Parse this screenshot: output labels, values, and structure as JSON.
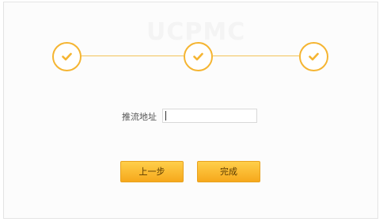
{
  "header": {
    "watermark_text": "UCPMC"
  },
  "steps": [
    {
      "state": "complete",
      "icon": "check-icon"
    },
    {
      "state": "complete",
      "icon": "check-icon"
    },
    {
      "state": "complete",
      "icon": "check-icon"
    }
  ],
  "form": {
    "stream_address_label": "推流地址",
    "stream_address_value": "",
    "stream_address_placeholder": ""
  },
  "buttons": {
    "prev_label": "上一步",
    "done_label": "完成"
  },
  "colors": {
    "accent": "#f5b532",
    "button_top": "#ffcf4a",
    "button_bottom": "#f6a81c"
  }
}
